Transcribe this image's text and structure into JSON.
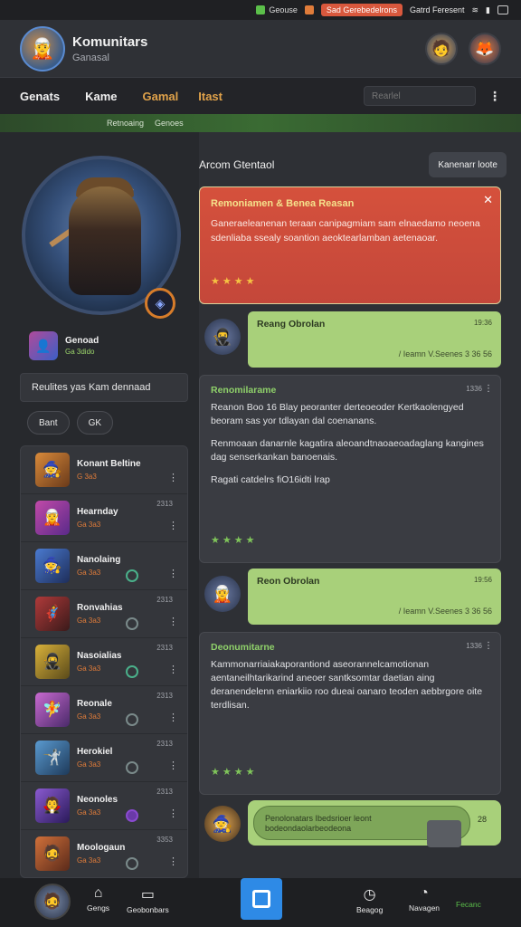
{
  "status_bar": {
    "chip1": "Geouse",
    "chip2": "Sad Gerebedelrons",
    "chip3": "Gatrd Feresent"
  },
  "header": {
    "title": "Komunitars",
    "subtitle": "Ganasal"
  },
  "nav": {
    "items": [
      "Genats",
      "Kame",
      "Gamal",
      "Itast"
    ],
    "search_placeholder": "Rearlel",
    "sub_items": [
      "Retnoaing",
      "Genoes"
    ]
  },
  "profile": {
    "name": "Genoad",
    "sub": "Ga 3dido"
  },
  "filter": {
    "label": "Reulites yas Kam dennaad"
  },
  "pills": [
    "Bant",
    "GK"
  ],
  "characters": [
    {
      "name": "Konant Beltine",
      "meta": "G 3a3",
      "num": ""
    },
    {
      "name": "Hearnday",
      "meta": "Ga 3a3",
      "num": "2313"
    },
    {
      "name": "Nanolaing",
      "meta": "Ga 3a3",
      "num": ""
    },
    {
      "name": "Ronvahias",
      "meta": "Ga 3a3",
      "num": "2313"
    },
    {
      "name": "Nasoialias",
      "meta": "Ga 3a3",
      "num": "2313"
    },
    {
      "name": "Reonale",
      "meta": "Ga 3a3",
      "num": "2313"
    },
    {
      "name": "Herokiel",
      "meta": "Ga 3a3",
      "num": "2313"
    },
    {
      "name": "Neonoles",
      "meta": "Ga 3a3",
      "num": "2313"
    },
    {
      "name": "Moologaun",
      "meta": "Ga 3a3",
      "num": "3353"
    }
  ],
  "right": {
    "title": "Arcom Gtentaol",
    "button": "Kanenarr loote"
  },
  "alert": {
    "title": "Remoniamen & Benea Reasan",
    "body": "Ganeraeleanenan teraan canipagmiam sam elnaedamo neoena sdenliaba ssealy soantion aeoktearlamban aetenaoar."
  },
  "messages": [
    {
      "name": "Reang Obrolan",
      "time": "19:36",
      "sub": "/ Ieamn V.Seenes 3 36 56"
    },
    {
      "name": "Reon Obrolan",
      "time": "19:56",
      "sub": "/ Ieamn V.Seenes 3 36 56"
    }
  ],
  "posts": [
    {
      "title": "Renomilarame",
      "num": "1336",
      "paras": [
        "Reanon Boo 16 Blay peoranter derteoeoder Kertkaolengyed beoram sas yor tdlayan dal coenanans.",
        "Renmoaan danarnle kagatira aleoandtnaoaeoadaglang kangines dag senserkankan banoenais.",
        "Ragati catdelrs fiO16idti lrap"
      ]
    },
    {
      "title": "Deonumitarne",
      "num": "1336",
      "paras": [
        "Kammonarriaiakaporantiond aseorannelcamotionan aentaneilhtarikarind aneoer santksomtar daetian aing deranendelenn eniarkiio roo dueai oanaro teoden aebbrgore oite terdlisan."
      ]
    }
  ],
  "compose": {
    "text": "Penolonatars Ibedsrioer leont bodeondaolarbeodeona",
    "count": "28"
  },
  "bottom_nav": {
    "items": [
      "Gengs",
      "Geobonbars",
      "Beagog",
      "Navagen"
    ],
    "active": "Fecanc"
  }
}
